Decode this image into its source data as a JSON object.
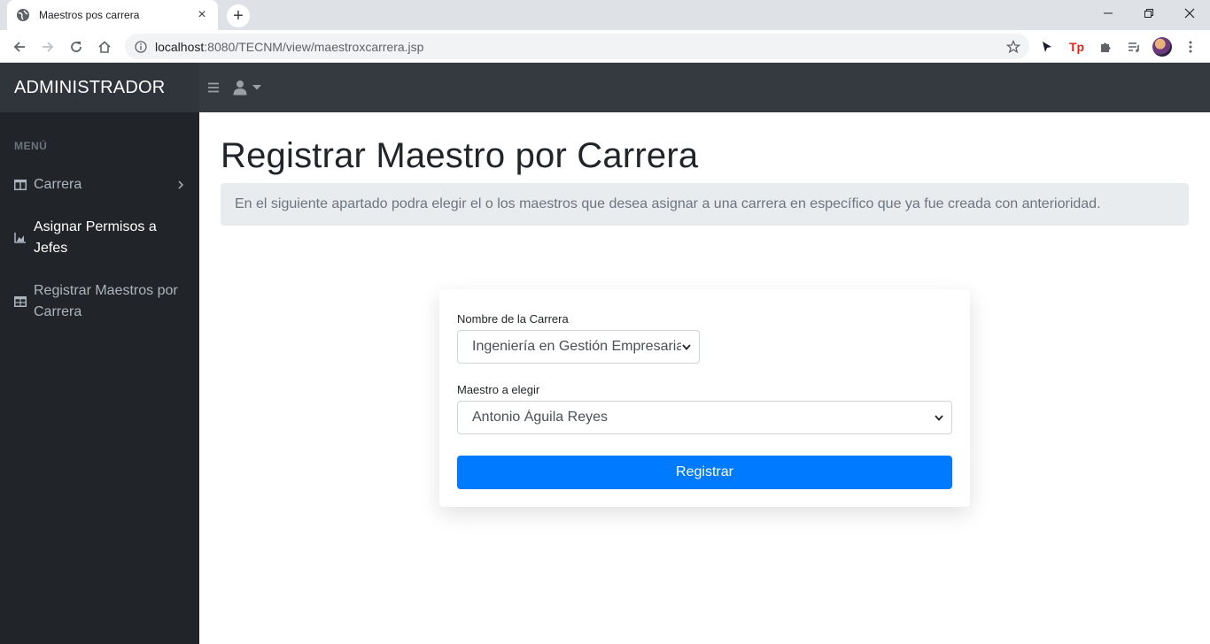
{
  "browser": {
    "tab_title": "Maestros pos carrera",
    "url_host": "localhost",
    "url_rest": ":8080/TECNM/view/maestroxcarrera.jsp"
  },
  "app": {
    "brand": "ADMINISTRADOR"
  },
  "sidebar": {
    "heading": "MENÚ",
    "items": [
      {
        "label": "Carrera",
        "icon": "columns-icon"
      },
      {
        "label": "Asignar Permisos a Jefes",
        "icon": "chart-area-icon"
      },
      {
        "label": "Registrar Maestros por Carrera",
        "icon": "table-icon"
      }
    ]
  },
  "main": {
    "title": "Registrar Maestro por Carrera",
    "description": "En el siguiente apartado podra elegir el o los maestros que desea asignar a una carrera en específico que ya fue creada con anterioridad.",
    "form": {
      "carrera_label": "Nombre de la Carrera",
      "carrera_value": "Ingeniería en Gestión Empresarial",
      "maestro_label": "Maestro a elegir",
      "maestro_value": "Antonio Águila Reyes",
      "submit_label": "Registrar"
    }
  },
  "colors": {
    "sidebar_bg": "#212529",
    "topnav_bg": "#343a40",
    "primary": "#007bff",
    "jumbotron_bg": "#e9ecef"
  }
}
